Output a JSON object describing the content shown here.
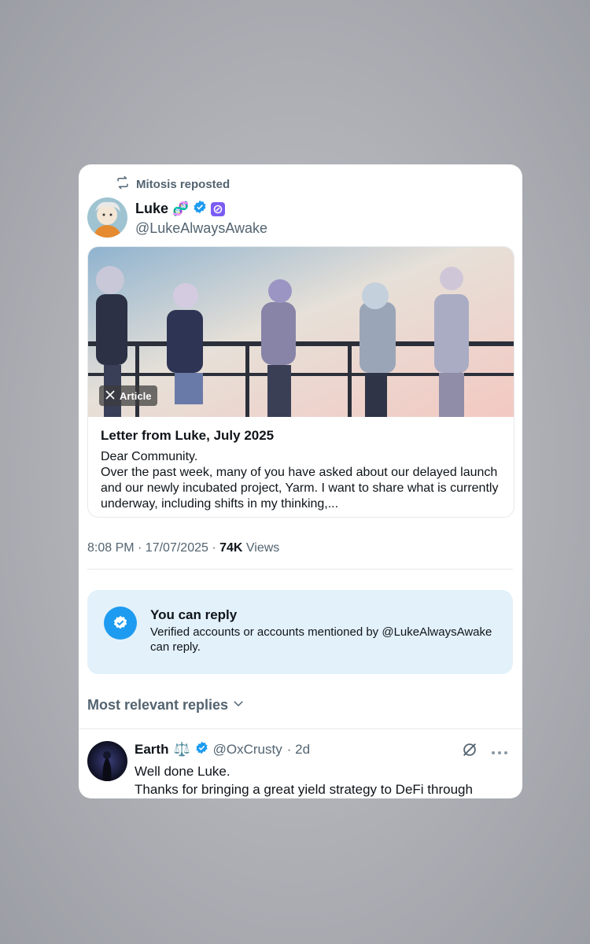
{
  "repost": {
    "label": "Mitosis reposted"
  },
  "author": {
    "name": "Luke",
    "emoji": "🧬",
    "handle": "@LukeAlwaysAwake"
  },
  "article": {
    "badge": "Article",
    "title": "Letter from Luke, July 2025",
    "greeting": "Dear Community.",
    "body": "Over the past week, many of you have asked about our delayed launch and our newly incubated project, Yarm. I want to share what is currently underway, including shifts in my thinking,..."
  },
  "meta": {
    "time": "8:08 PM · 17/07/2025 · ",
    "views_count": "74K",
    "views_label": " Views"
  },
  "reply_notice": {
    "title": "You can reply",
    "desc": "Verified accounts or accounts mentioned by @LukeAlwaysAwake can reply."
  },
  "replies_filter": {
    "label": "Most relevant replies"
  },
  "reply": {
    "name": "Earth",
    "emoji": "⚖️",
    "handle": "@OxCrusty",
    "time": "· 2d",
    "line1": "Well done Luke.",
    "line2": "Thanks for bringing a great yield strategy to DeFi through mitosis"
  },
  "colors": {
    "accent": "#1d9bf0",
    "reply_bg": "#e3f1fb",
    "muted": "#536471"
  }
}
